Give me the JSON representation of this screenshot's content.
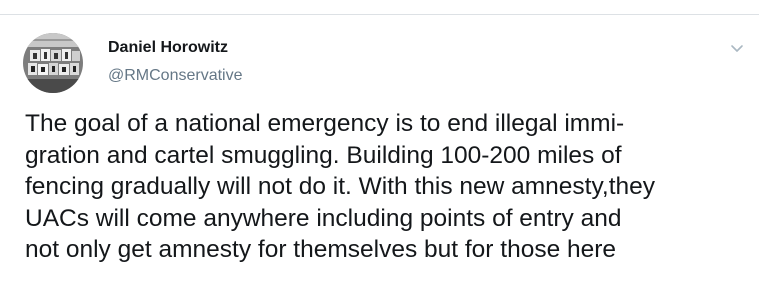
{
  "tweet": {
    "author": {
      "display_name": "Daniel Horowitz",
      "handle": "@RMConservative",
      "avatar": "profile-avatar"
    },
    "menu_icon": "chevron-down-icon",
    "text_lines": [
      "The goal of a national emergency is to end illegal immi-",
      "gration and cartel smuggling. Building 100-200 miles of",
      "fencing gradually will not do it. With this new amnesty,they",
      "UACs will come anywhere including points of entry and",
      "not only get amnesty for themselves but for those here"
    ]
  },
  "colors": {
    "text": "#14171a",
    "secondary_text": "#657786",
    "divider": "#dde1e5",
    "caret": "#aab8c2"
  }
}
